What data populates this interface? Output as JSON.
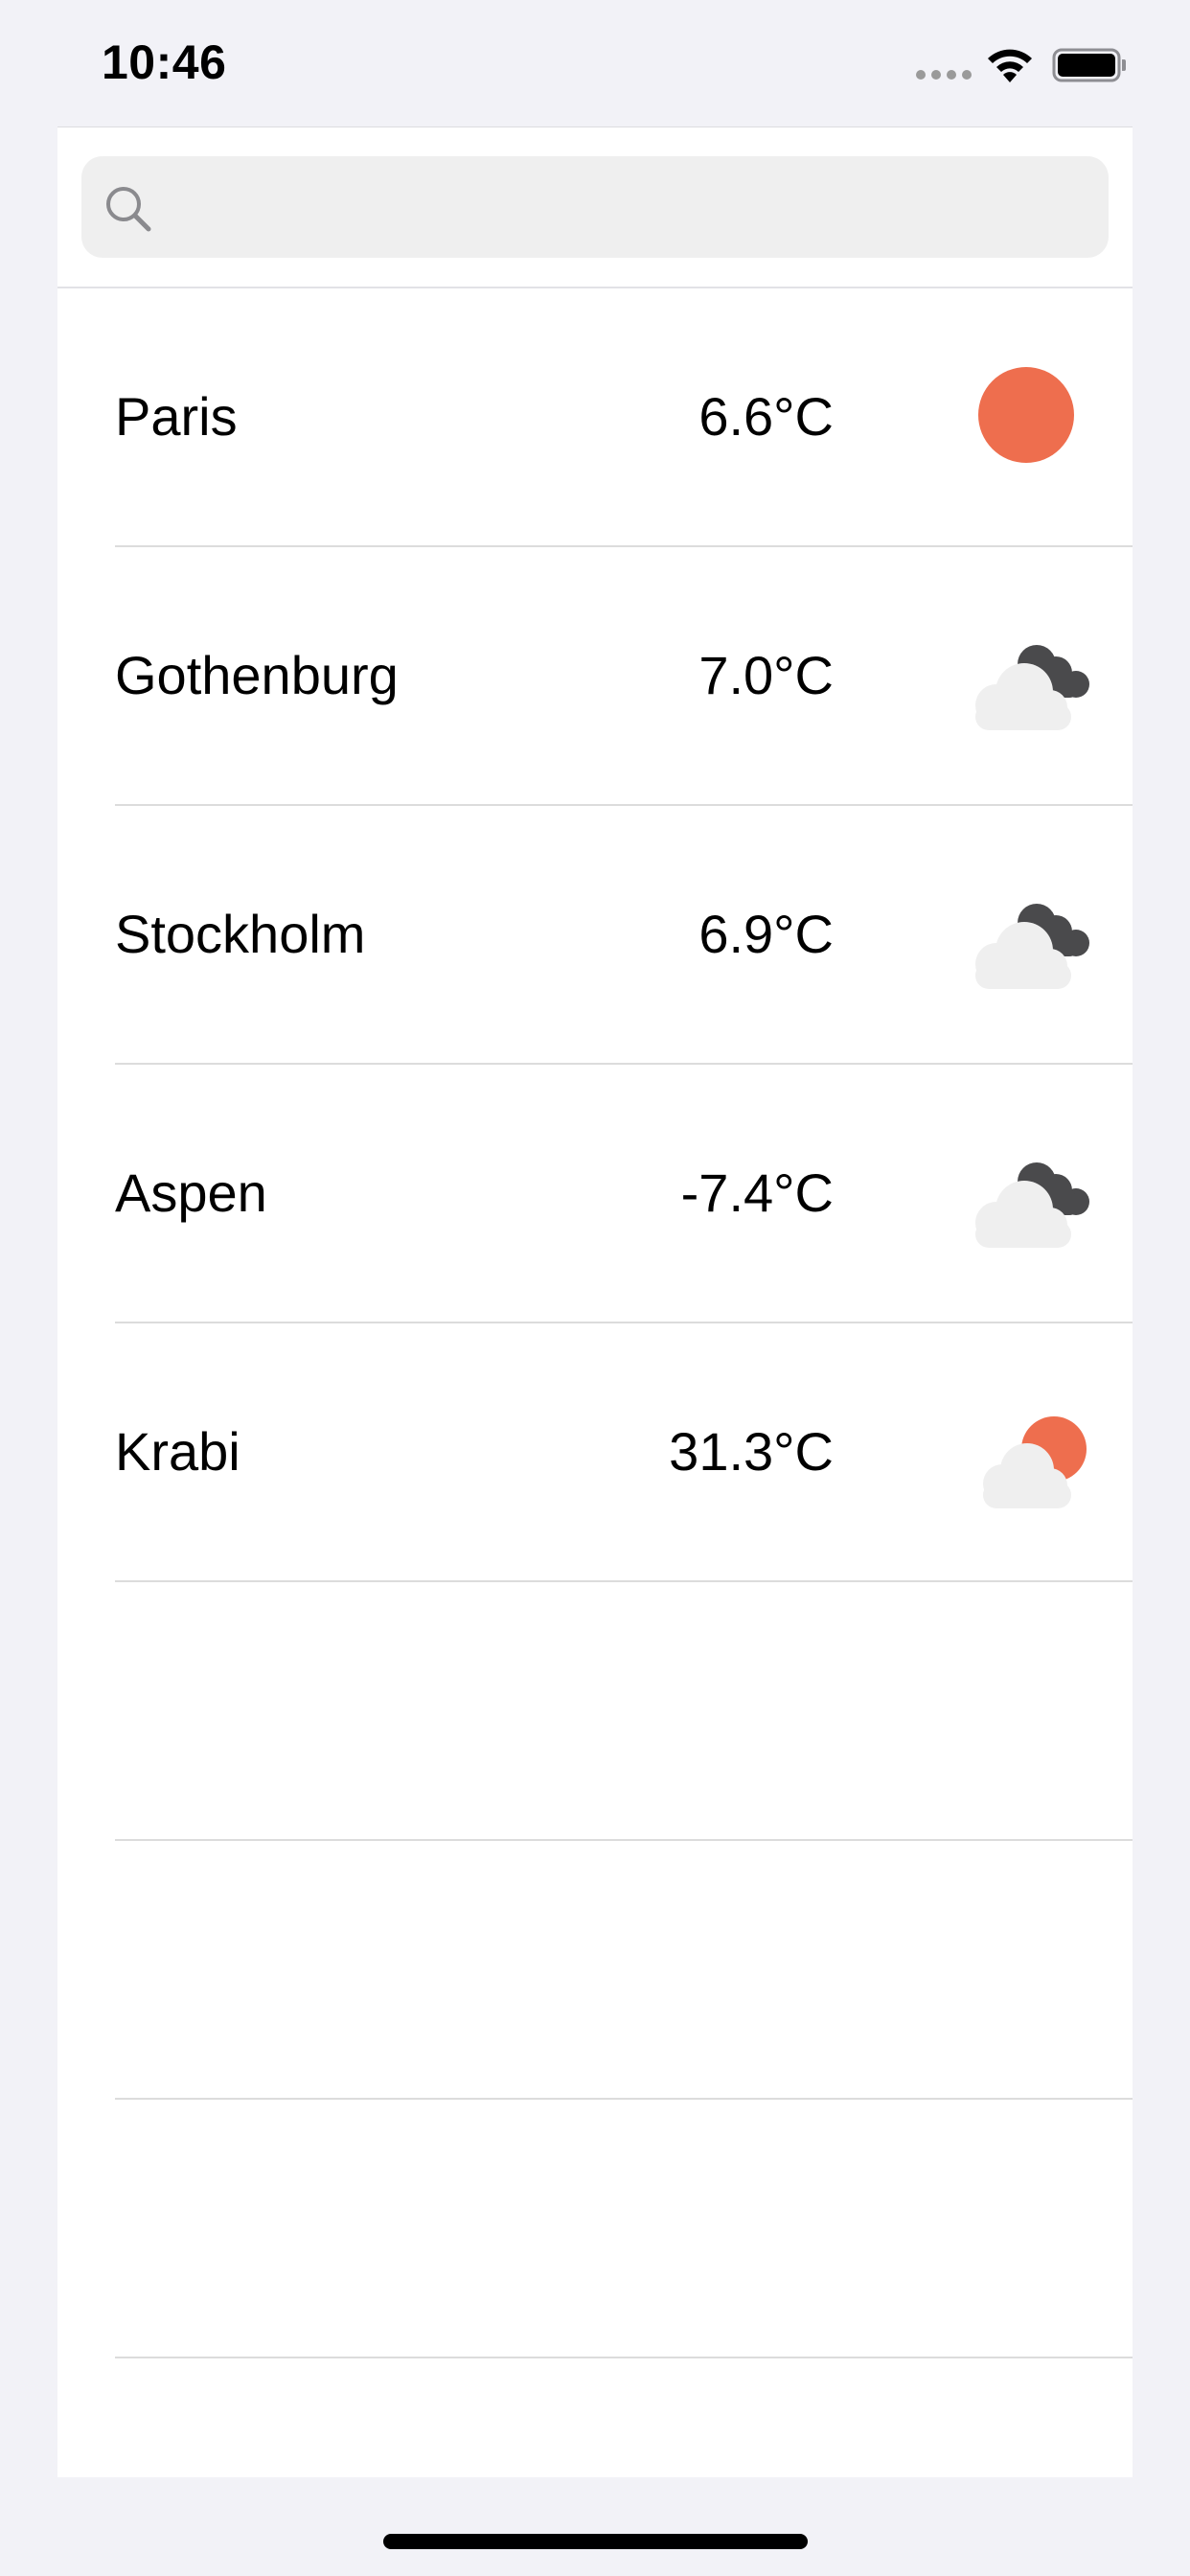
{
  "status_bar": {
    "time": "10:46",
    "icons": [
      "cellular-dots-icon",
      "wifi-icon",
      "battery-icon"
    ]
  },
  "search": {
    "placeholder": "",
    "value": "",
    "icon": "search-icon"
  },
  "colors": {
    "sun": "#ee6e4e",
    "dark_cloud": "#4a4a4c",
    "light_cloud": "#efefef",
    "separator": "#dcdcdc"
  },
  "cities": [
    {
      "name": "Paris",
      "temperature": "6.6°C",
      "icon": "sun-icon"
    },
    {
      "name": "Gothenburg",
      "temperature": "7.0°C",
      "icon": "cloudy-icon"
    },
    {
      "name": "Stockholm",
      "temperature": "6.9°C",
      "icon": "cloudy-icon"
    },
    {
      "name": "Aspen",
      "temperature": "-7.4°C",
      "icon": "cloudy-icon"
    },
    {
      "name": "Krabi",
      "temperature": "31.3°C",
      "icon": "partly-sunny-icon"
    }
  ]
}
